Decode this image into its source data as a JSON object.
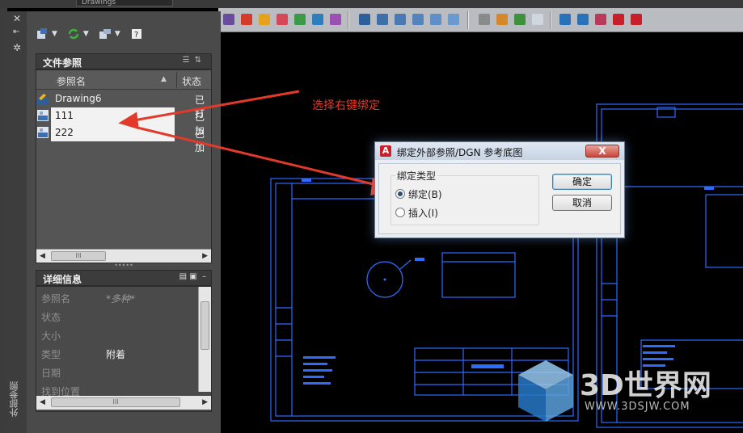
{
  "window": {
    "drawing_tab": "Drawings"
  },
  "palette": {
    "title": "外部参照",
    "files_section": {
      "title": "文件参照",
      "columns": {
        "name": "参照名",
        "status": "状态"
      },
      "rows": [
        {
          "name": "Drawing6",
          "status": "已打",
          "icon": "dwg-master-icon",
          "selected": false
        },
        {
          "name": "111",
          "status": "已加",
          "icon": "dwg-ref-icon",
          "selected": true
        },
        {
          "name": "222",
          "status": "已加",
          "icon": "dwg-ref-icon",
          "selected": true
        }
      ]
    },
    "details_section": {
      "title": "详细信息",
      "rows": [
        {
          "key": "参照名",
          "value": "*多种*"
        },
        {
          "key": "状态",
          "value": ""
        },
        {
          "key": "大小",
          "value": ""
        },
        {
          "key": "类型",
          "value": "附着"
        },
        {
          "key": "日期",
          "value": ""
        },
        {
          "key": "找到位置",
          "value": ""
        }
      ]
    }
  },
  "annotation": {
    "text": "选择右键绑定",
    "color": "#e23a2a"
  },
  "dialog": {
    "title": "绑定外部参照/DGN 参考底图",
    "close_label": "X",
    "group_label": "绑定类型",
    "options": [
      {
        "label": "绑定(B)",
        "checked": true
      },
      {
        "label": "插入(I)",
        "checked": false
      }
    ],
    "ok_label": "确定",
    "cancel_label": "取消"
  },
  "watermark": {
    "text": "3D世界网",
    "url": "WWW.3DSJW.COM"
  },
  "colors": {
    "drawing_lines": "#2f6bff",
    "arrow": "#e23a2a",
    "toolbar": "#b9bcc0"
  }
}
